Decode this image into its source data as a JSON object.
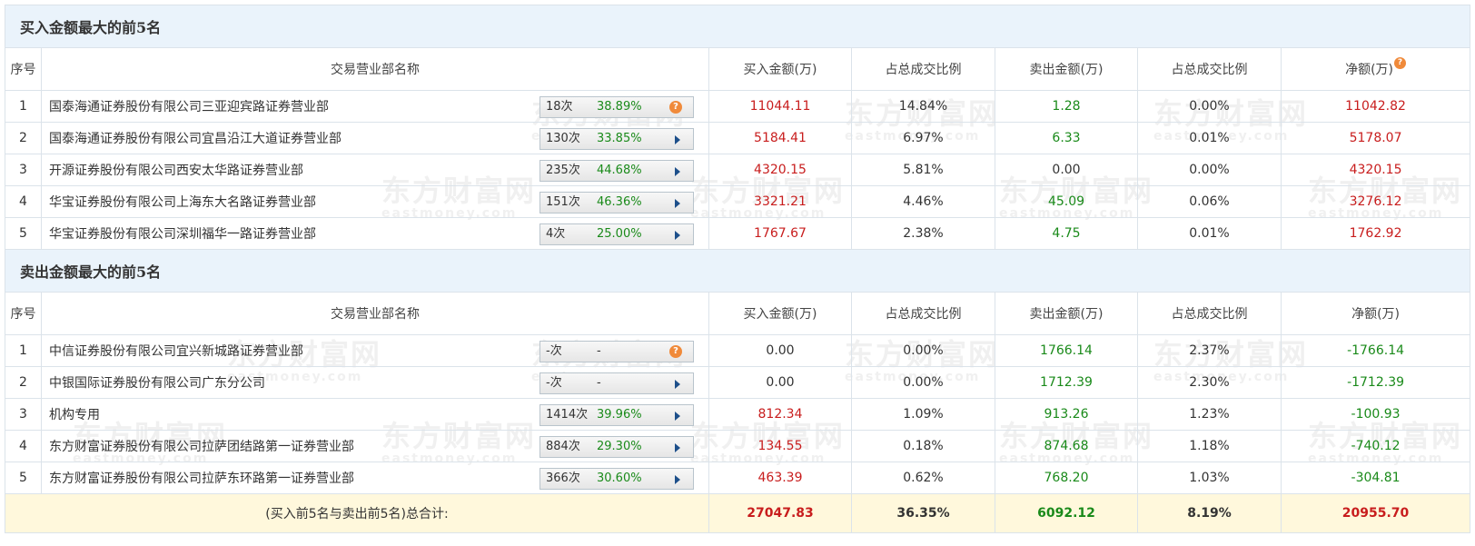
{
  "colors": {
    "up": "#c81d1d",
    "down": "#1a8a1a",
    "header_bg": "#eaf3fb",
    "total_bg": "#fff8dc"
  },
  "watermark": {
    "cn": "东方财富网",
    "en": "eastmoney.com"
  },
  "buy_section": {
    "title": "买入金额最大的前5名",
    "headers": {
      "idx": "序号",
      "name": "交易营业部名称",
      "buy": "买入金额(万)",
      "buy_ratio": "占总成交比例",
      "sell": "卖出金额(万)",
      "sell_ratio": "占总成交比例",
      "net": "净额(万)"
    },
    "rows": [
      {
        "idx": "1",
        "name": "国泰海通证券股份有限公司三亚迎宾路证券营业部",
        "count": "18次",
        "pct": "38.89%",
        "buy": "11044.11",
        "buy_ratio": "14.84%",
        "sell": "1.28",
        "sell_ratio": "0.00%",
        "net": "11042.82"
      },
      {
        "idx": "2",
        "name": "国泰海通证券股份有限公司宜昌沿江大道证券营业部",
        "count": "130次",
        "pct": "33.85%",
        "buy": "5184.41",
        "buy_ratio": "6.97%",
        "sell": "6.33",
        "sell_ratio": "0.01%",
        "net": "5178.07"
      },
      {
        "idx": "3",
        "name": "开源证券股份有限公司西安太华路证券营业部",
        "count": "235次",
        "pct": "44.68%",
        "buy": "4320.15",
        "buy_ratio": "5.81%",
        "sell": "0.00",
        "sell_ratio": "0.00%",
        "net": "4320.15"
      },
      {
        "idx": "4",
        "name": "华宝证券股份有限公司上海东大名路证券营业部",
        "count": "151次",
        "pct": "46.36%",
        "buy": "3321.21",
        "buy_ratio": "4.46%",
        "sell": "45.09",
        "sell_ratio": "0.06%",
        "net": "3276.12"
      },
      {
        "idx": "5",
        "name": "华宝证券股份有限公司深圳福华一路证券营业部",
        "count": "4次",
        "pct": "25.00%",
        "buy": "1767.67",
        "buy_ratio": "2.38%",
        "sell": "4.75",
        "sell_ratio": "0.01%",
        "net": "1762.92"
      }
    ]
  },
  "sell_section": {
    "title": "卖出金额最大的前5名",
    "headers": {
      "idx": "序号",
      "name": "交易营业部名称",
      "buy": "买入金额(万)",
      "buy_ratio": "占总成交比例",
      "sell": "卖出金额(万)",
      "sell_ratio": "占总成交比例",
      "net": "净额(万)"
    },
    "rows": [
      {
        "idx": "1",
        "name": "中信证券股份有限公司宜兴新城路证券营业部",
        "count": "-次",
        "pct": "-",
        "buy": "0.00",
        "buy_ratio": "0.00%",
        "sell": "1766.14",
        "sell_ratio": "2.37%",
        "net": "-1766.14"
      },
      {
        "idx": "2",
        "name": "中银国际证券股份有限公司广东分公司",
        "count": "-次",
        "pct": "-",
        "buy": "0.00",
        "buy_ratio": "0.00%",
        "sell": "1712.39",
        "sell_ratio": "2.30%",
        "net": "-1712.39"
      },
      {
        "idx": "3",
        "name": "机构专用",
        "count": "1414次",
        "pct": "39.96%",
        "buy": "812.34",
        "buy_ratio": "1.09%",
        "sell": "913.26",
        "sell_ratio": "1.23%",
        "net": "-100.93"
      },
      {
        "idx": "4",
        "name": "东方财富证券股份有限公司拉萨团结路第一证券营业部",
        "count": "884次",
        "pct": "29.30%",
        "buy": "134.55",
        "buy_ratio": "0.18%",
        "sell": "874.68",
        "sell_ratio": "1.18%",
        "net": "-740.12"
      },
      {
        "idx": "5",
        "name": "东方财富证券股份有限公司拉萨东环路第一证券营业部",
        "count": "366次",
        "pct": "30.60%",
        "buy": "463.39",
        "buy_ratio": "0.62%",
        "sell": "768.20",
        "sell_ratio": "1.03%",
        "net": "-304.81"
      }
    ]
  },
  "total": {
    "label": "(买入前5名与卖出前5名)总合计:",
    "buy": "27047.83",
    "buy_ratio": "36.35%",
    "sell": "6092.12",
    "sell_ratio": "8.19%",
    "net": "20955.70"
  },
  "help_glyph": "?"
}
